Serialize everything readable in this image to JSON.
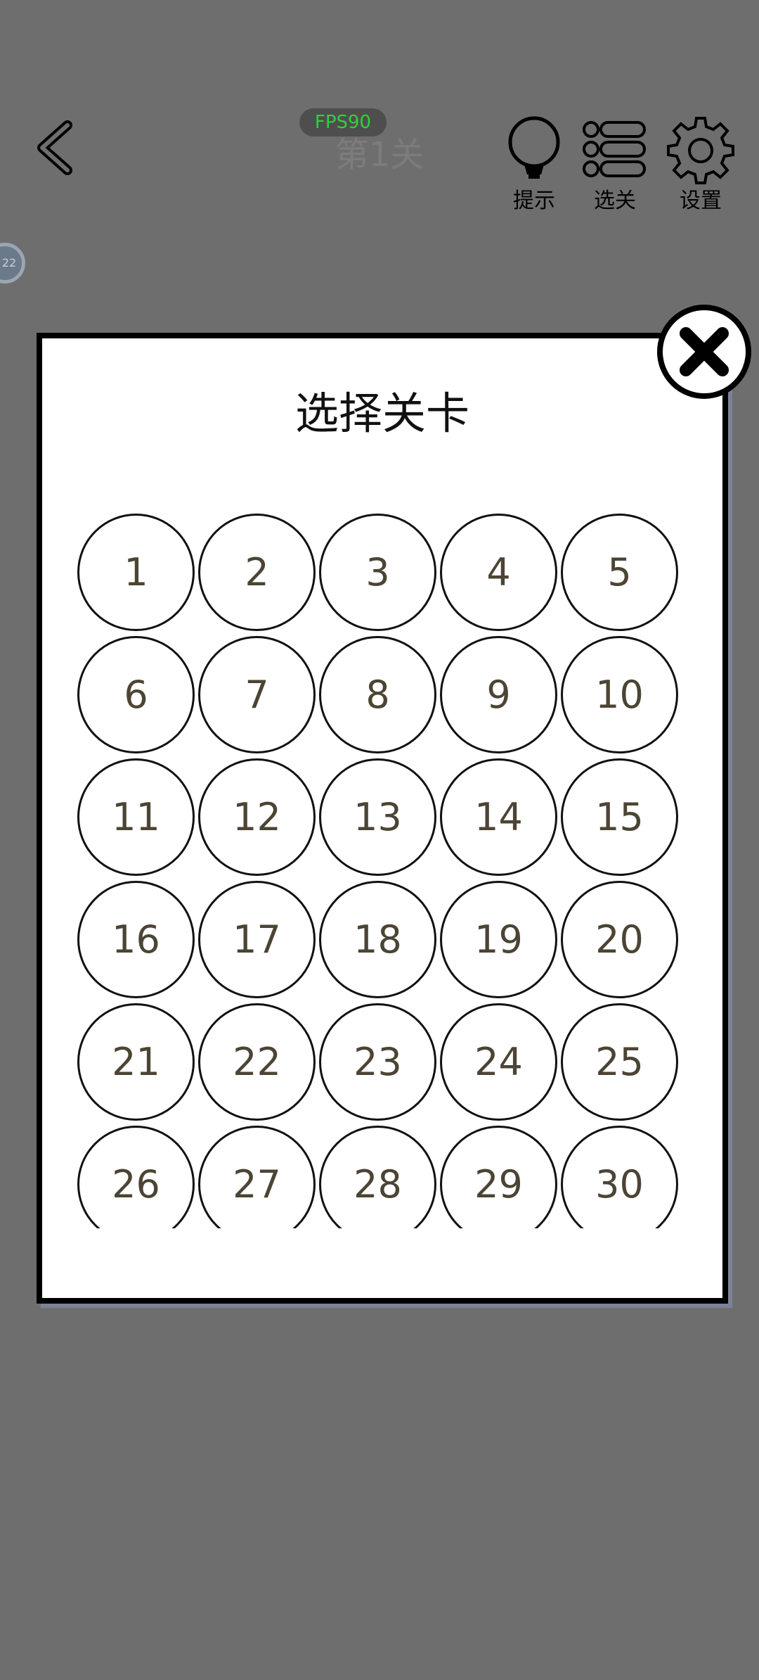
{
  "topbar": {
    "back_icon": "chevron-left-icon",
    "fps_label": "FPS90",
    "level_title": "第1关",
    "tools": [
      {
        "icon": "lightbulb-icon",
        "label": "提示"
      },
      {
        "icon": "list-icon",
        "label": "选关"
      },
      {
        "icon": "gear-icon",
        "label": "设置"
      }
    ]
  },
  "side_coin": {
    "text": "22"
  },
  "dialog": {
    "title": "选择关卡",
    "close_icon": "close-icon",
    "levels": [
      "1",
      "2",
      "3",
      "4",
      "5",
      "6",
      "7",
      "8",
      "9",
      "10",
      "11",
      "12",
      "13",
      "14",
      "15",
      "16",
      "17",
      "18",
      "19",
      "20",
      "21",
      "22",
      "23",
      "24",
      "25",
      "26",
      "27",
      "28",
      "29",
      "30"
    ]
  },
  "colors": {
    "background": "#6e6e6e",
    "fps_text": "#2fd23a",
    "level_number": "#4c4434",
    "dialog_border": "#000000"
  }
}
